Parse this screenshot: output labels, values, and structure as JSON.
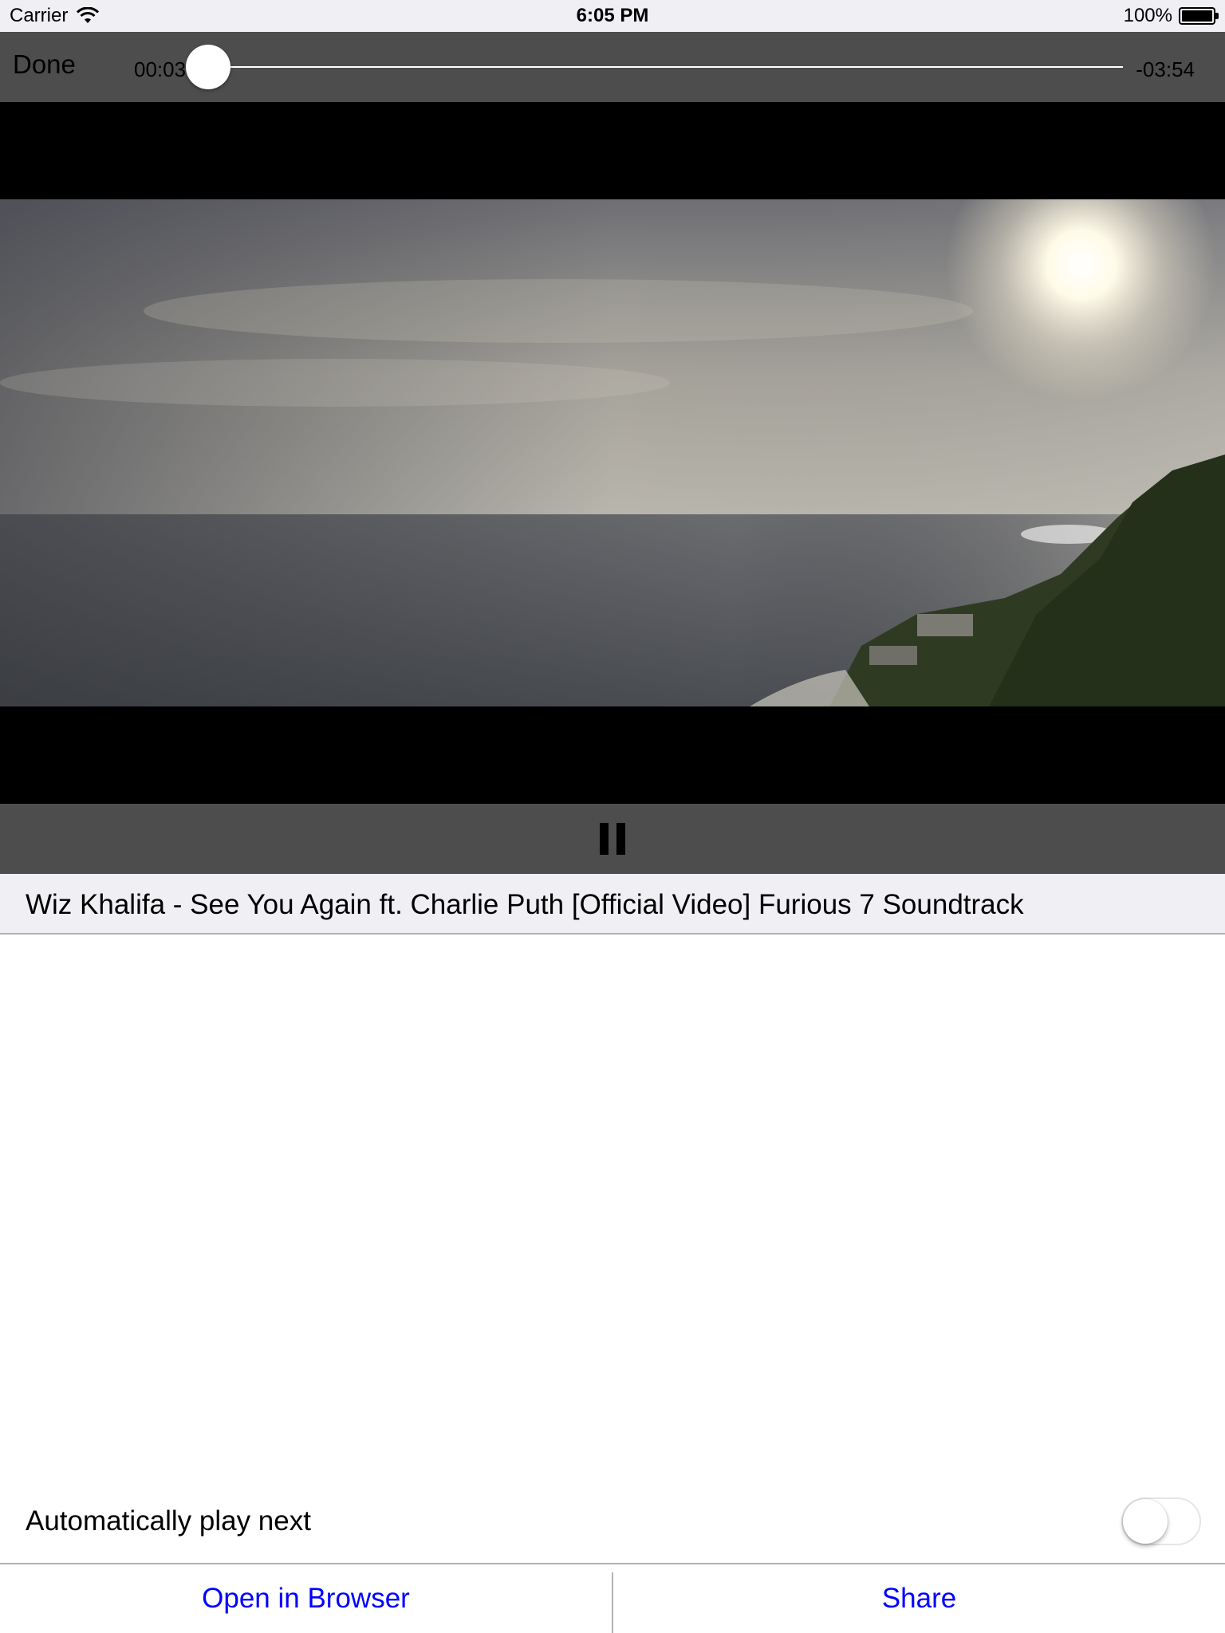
{
  "status_bar": {
    "carrier": "Carrier",
    "time": "6:05 PM",
    "battery": "100%",
    "icons": [
      "wifi-icon",
      "battery-icon"
    ]
  },
  "player": {
    "done_label": "Done",
    "elapsed": "00:03",
    "remaining": "-03:54",
    "progress_fraction": 0.013,
    "pause_icon": "pause-icon",
    "colors": {
      "controls_bg": "#4d4d4d",
      "letterbox": "#000000"
    }
  },
  "video": {
    "title": "Wiz Khalifa - See You Again ft. Charlie Puth [Official Video] Furious 7 Soundtrack"
  },
  "settings": {
    "autoplay_label": "Automatically play next",
    "autoplay_on": false
  },
  "actions": {
    "open_browser_label": "Open in Browser",
    "share_label": "Share",
    "link_color": "#0000ff"
  }
}
